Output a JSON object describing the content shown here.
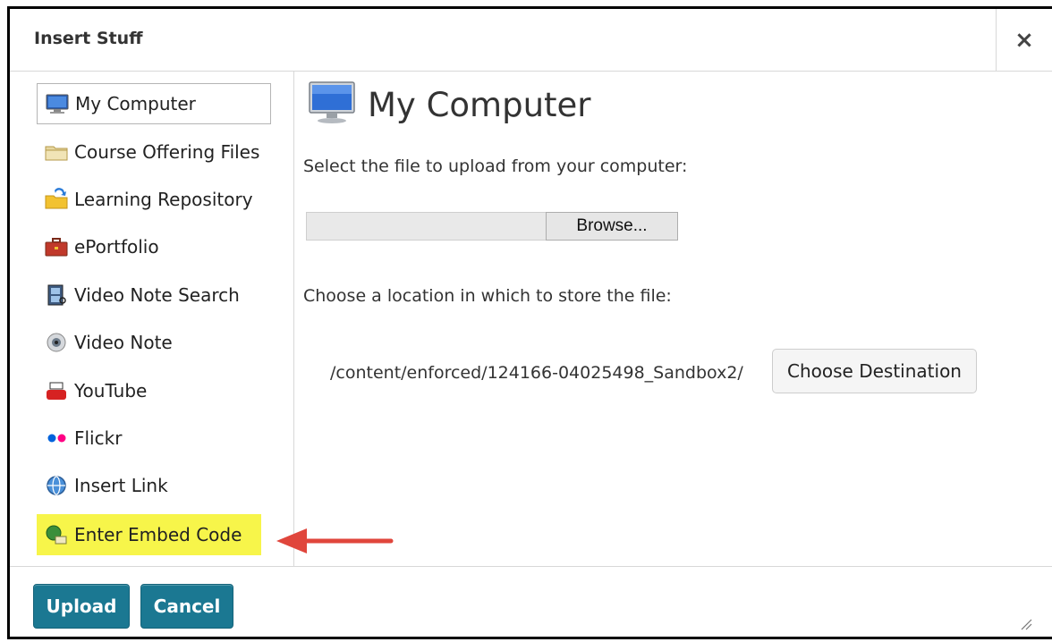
{
  "dialog": {
    "title": "Insert Stuff",
    "close_symbol": "×"
  },
  "sidebar": {
    "items": [
      {
        "label": "My Computer",
        "icon": "monitor-icon",
        "selected": true
      },
      {
        "label": "Course Offering Files",
        "icon": "folder-icon"
      },
      {
        "label": "Learning Repository",
        "icon": "repository-folder-icon"
      },
      {
        "label": "ePortfolio",
        "icon": "briefcase-icon"
      },
      {
        "label": "Video Note Search",
        "icon": "film-search-icon"
      },
      {
        "label": "Video Note",
        "icon": "webcam-icon"
      },
      {
        "label": "YouTube",
        "icon": "youtube-icon"
      },
      {
        "label": "Flickr",
        "icon": "flickr-icon"
      },
      {
        "label": "Insert Link",
        "icon": "globe-link-icon"
      },
      {
        "label": "Enter Embed Code",
        "icon": "embed-code-icon",
        "highlighted": true
      }
    ]
  },
  "main": {
    "title": "My Computer",
    "upload_prompt": "Select the file to upload from your computer:",
    "browse_label": "Browse...",
    "location_prompt": "Choose a location in which to store the file:",
    "destination_path": "/content/enforced/124166-04025498_Sandbox2/",
    "choose_destination_label": "Choose Destination"
  },
  "footer": {
    "upload_label": "Upload",
    "cancel_label": "Cancel"
  },
  "colors": {
    "primary_button": "#1b7892",
    "highlight": "#f7f54a",
    "annotation_arrow": "#e0463c"
  }
}
